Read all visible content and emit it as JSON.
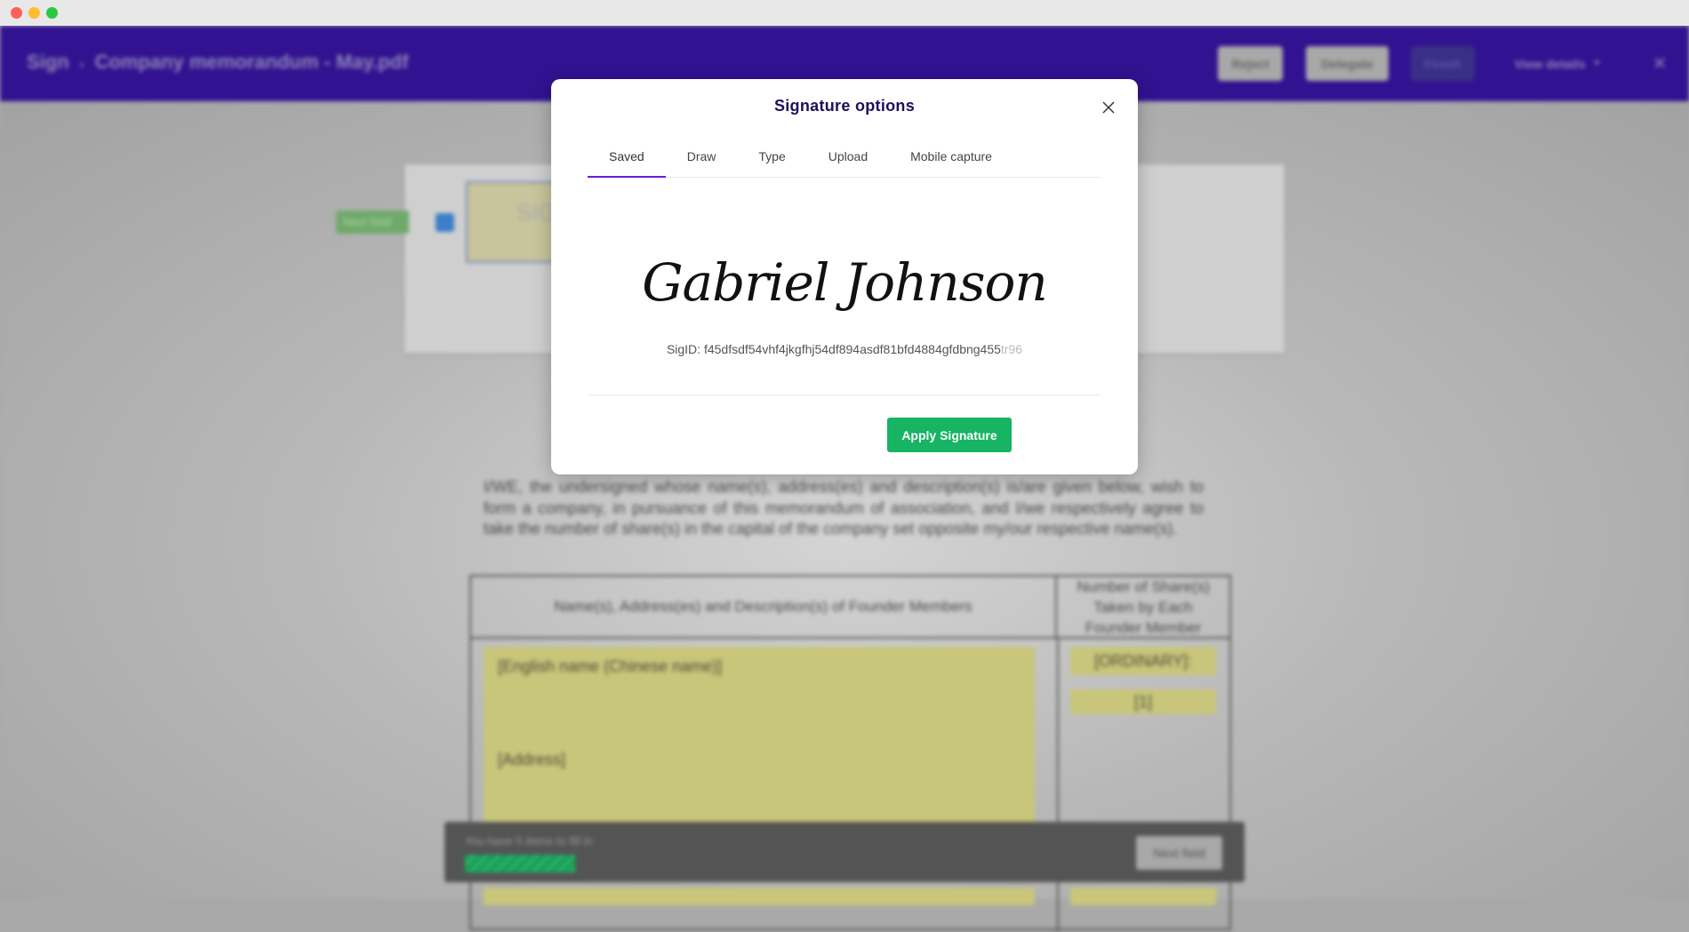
{
  "window": {
    "controls": [
      "close",
      "minimize",
      "maximize"
    ]
  },
  "header": {
    "breadcrumb_root": "Sign",
    "breadcrumb_sep": "›",
    "document_title": "Company memorandum - May.pdf",
    "reject": "Reject",
    "delegate": "Delegate",
    "finish": "Finish",
    "view_details": "View details",
    "brand_color": "#311290"
  },
  "document": {
    "next_field_tag": "Next field",
    "signature_field_label": "SIG",
    "paragraph": "I/WE, the undersigned whose name(s), address(es) and description(s) is/are given below, wish to form a company, in pursuance of this memorandum of association, and I/we respectively agree to take the number of share(s) in the capital of the company set opposite my/our respective name(s).",
    "table": {
      "col1_header": "Name(s), Address(es) and Description(s) of Founder Members",
      "col2_header": "Number of Share(s) Taken by Each Founder Member",
      "name_field": "[English name (Chinese name)]",
      "address_field": "[Address]",
      "share_class": "[ORDINARY]:",
      "share_count": "[1]"
    }
  },
  "progress_bar": {
    "message": "You have 5 items to fill in",
    "next_field": "Next field",
    "fill_percent": 25,
    "color": "#16a05a"
  },
  "modal": {
    "title": "Signature options",
    "tabs": [
      {
        "label": "Saved",
        "active": true
      },
      {
        "label": "Draw"
      },
      {
        "label": "Type"
      },
      {
        "label": "Upload"
      },
      {
        "label": "Mobile capture"
      }
    ],
    "signature_name": "Gabriel Johnson",
    "sig_id_main": "SigID: f45dfsdf54vhf4jkgfhj54df894asdf81bfd4884gfdbng455",
    "sig_id_faded": "tr96",
    "apply": "Apply Signature",
    "accent": "#6a1be0",
    "apply_color": "#16b463"
  }
}
